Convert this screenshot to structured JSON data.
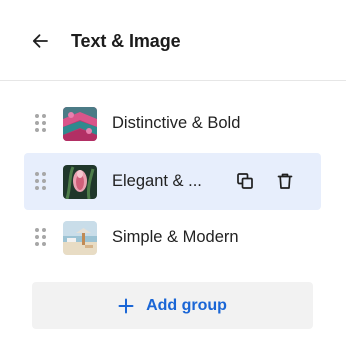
{
  "header": {
    "title": "Text & Image",
    "back_icon": "arrow-left-icon"
  },
  "groups": [
    {
      "label": "Distinctive & Bold",
      "thumbnail": "pink-pattern-image",
      "selected": false
    },
    {
      "label": "Elegant & ...",
      "thumbnail": "pink-flower-image",
      "selected": true,
      "actions": [
        {
          "icon": "duplicate-icon"
        },
        {
          "icon": "trash-icon"
        }
      ]
    },
    {
      "label": "Simple & Modern",
      "thumbnail": "beach-image",
      "selected": false
    }
  ],
  "add_group": {
    "label": "Add group",
    "icon": "plus-icon"
  },
  "colors": {
    "selected_row_bg": "#e7eefc",
    "accent": "#1a66d6",
    "button_bg": "#f2f2f2"
  }
}
